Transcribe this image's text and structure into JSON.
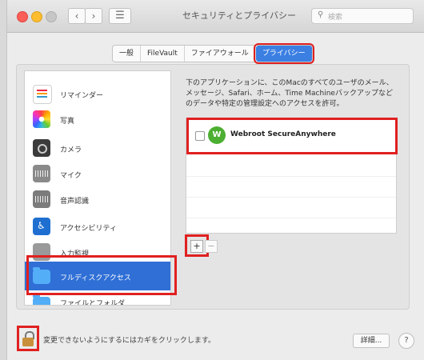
{
  "window": {
    "title": "セキュリティとプライバシー",
    "search_placeholder": "検索",
    "nav_back": "‹",
    "nav_forward": "›",
    "grid_icon": "grid-icon"
  },
  "tabs": [
    {
      "label": "一般",
      "active": false
    },
    {
      "label": "FileVault",
      "active": false
    },
    {
      "label": "ファイアウォール",
      "active": false
    },
    {
      "label": "プライバシー",
      "active": true
    }
  ],
  "sidebar": {
    "items": [
      {
        "label": "リマインダー",
        "icon": "reminders-icon"
      },
      {
        "label": "写真",
        "icon": "photos-icon"
      },
      {
        "label": "カメラ",
        "icon": "camera-icon"
      },
      {
        "label": "マイク",
        "icon": "microphone-icon"
      },
      {
        "label": "音声認識",
        "icon": "speech-icon"
      },
      {
        "label": "アクセシビリティ",
        "icon": "accessibility-icon"
      },
      {
        "label": "入力監視",
        "icon": "input-monitoring-icon"
      },
      {
        "label": "フルディスクアクセス",
        "icon": "folder-icon",
        "selected": true
      },
      {
        "label": "ファイルとフォルダ",
        "icon": "folder-icon"
      }
    ]
  },
  "main": {
    "description": "下のアプリケーションに、このMacのすべてのユーザのメール、メッセージ、Safari、ホーム、Time Machineバックアップなどのデータや特定の管理設定へのアクセスを許可。",
    "apps": [
      {
        "name": "Webroot SecureAnywhere",
        "icon_letter": "W",
        "checked": false
      }
    ],
    "plus_label": "+",
    "minus_label": "−"
  },
  "footer": {
    "lock_text": "変更できないようにするにはカギをクリックします。",
    "details_label": "詳細...",
    "help_label": "?"
  },
  "colors": {
    "accent": "#3b7fe3",
    "highlight_box": "#e02020"
  }
}
